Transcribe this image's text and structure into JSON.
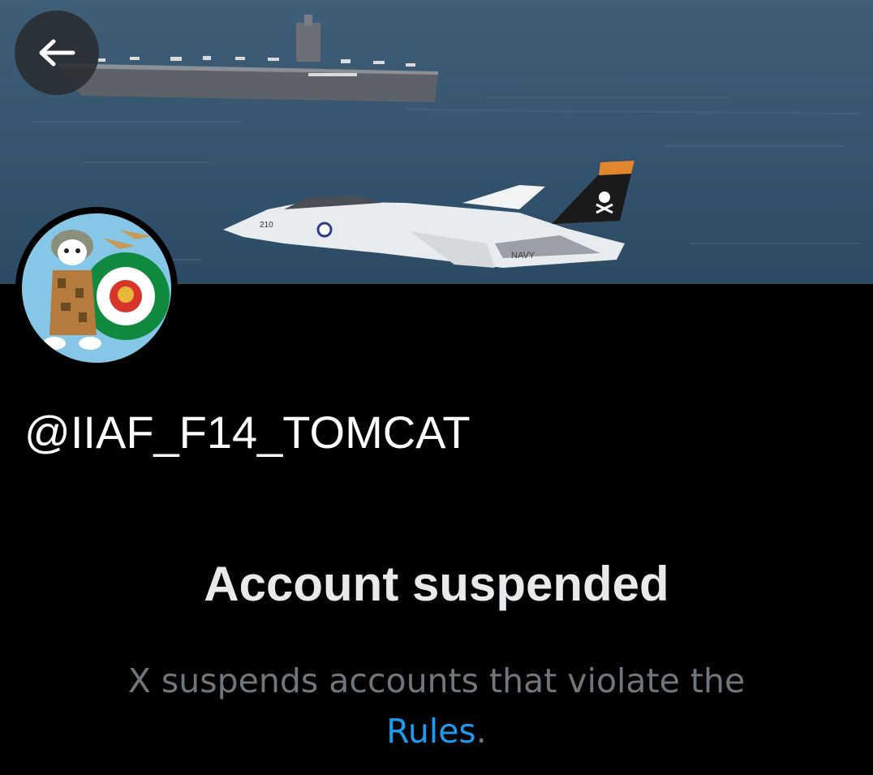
{
  "profile": {
    "handle": "@IIAF_F14_TOMCAT",
    "back_icon": "arrow-left-icon"
  },
  "suspension": {
    "title": "Account suspended",
    "message_line1": "X suspends accounts that violate the",
    "rules_link": "Rules",
    "period": "."
  },
  "banner": {
    "aircraft_text": "NAVY",
    "tail_number": "210"
  },
  "colors": {
    "background": "#000000",
    "title_text": "#e7e9ea",
    "muted_text": "#71767b",
    "link": "#1d9bf0"
  }
}
